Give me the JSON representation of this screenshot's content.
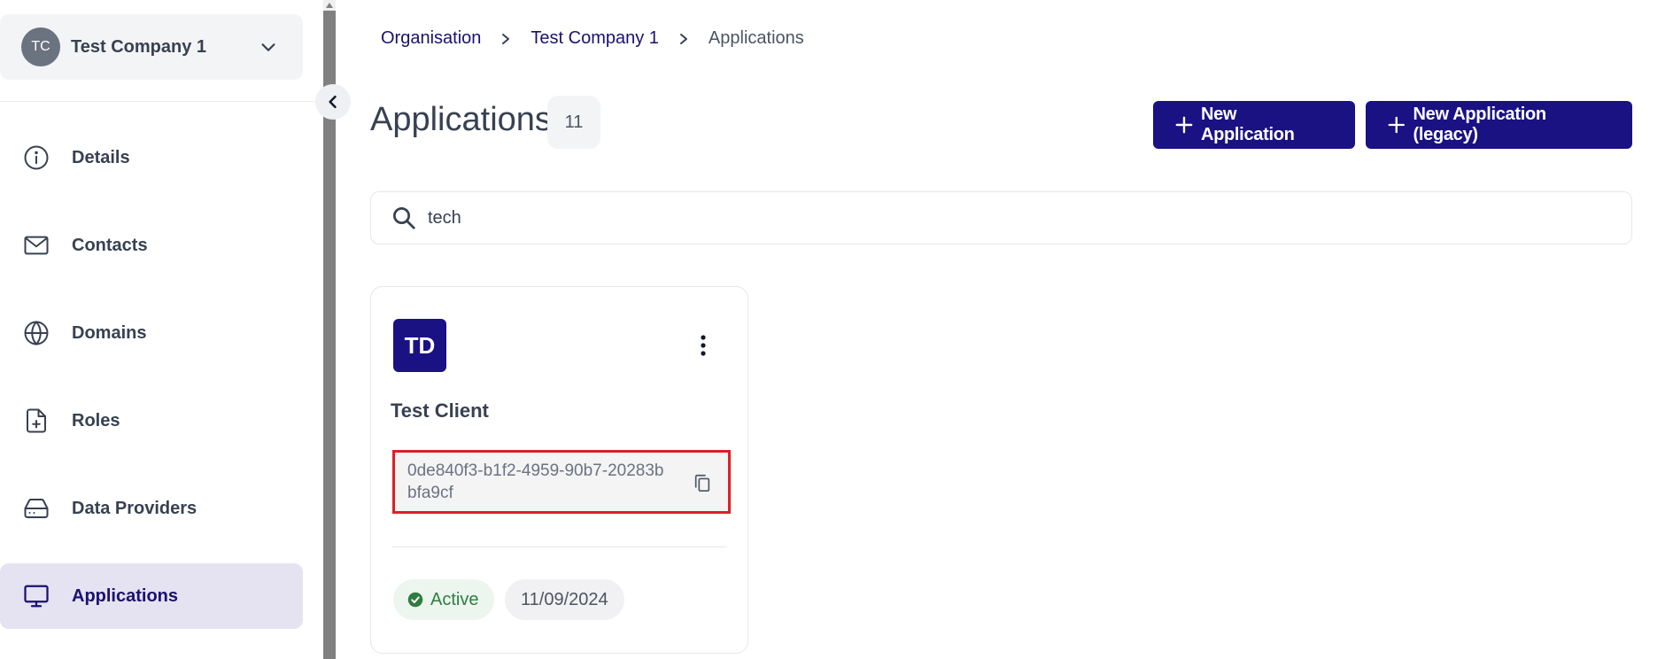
{
  "org": {
    "initials": "TC",
    "name": "Test Company 1"
  },
  "sidebar": {
    "items": [
      {
        "label": "Details",
        "icon": "info-icon"
      },
      {
        "label": "Contacts",
        "icon": "mail-icon"
      },
      {
        "label": "Domains",
        "icon": "globe-icon"
      },
      {
        "label": "Roles",
        "icon": "file-plus-icon"
      },
      {
        "label": "Data Providers",
        "icon": "hard-drive-icon"
      },
      {
        "label": "Applications",
        "icon": "monitor-icon",
        "active": true
      }
    ]
  },
  "breadcrumb": {
    "items": [
      "Organisation",
      "Test Company 1"
    ],
    "current": "Applications"
  },
  "page": {
    "title": "Applications",
    "count": "11"
  },
  "actions": {
    "new_application": "New Application",
    "new_application_legacy": "New Application (legacy)"
  },
  "search": {
    "value": "tech"
  },
  "cards": [
    {
      "initials": "TD",
      "title": "Test Client",
      "client_id": "0de840f3-b1f2-4959-90b7-20283bbfa9cf",
      "status": "Active",
      "date": "11/09/2024"
    }
  ],
  "colors": {
    "accent": "#1a1183",
    "active_bg": "#e5e2f1",
    "status_green": "#2f7d3e",
    "highlight_red": "#dc1f26"
  }
}
